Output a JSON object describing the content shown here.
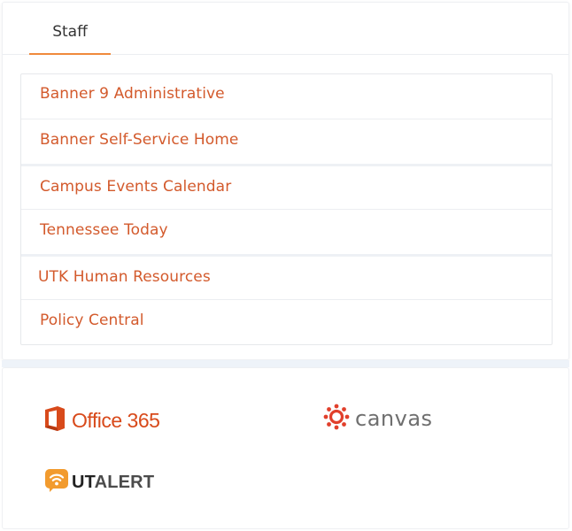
{
  "tabs": [
    {
      "label": "Staff",
      "active": true
    }
  ],
  "links": [
    {
      "label": "Banner 9 Administrative"
    },
    {
      "label": "Banner Self-Service Home"
    },
    {
      "label": "Campus Events Calendar"
    },
    {
      "label": "Tennessee Today"
    },
    {
      "label": "UTK Human Resources"
    },
    {
      "label": "Policy Central"
    }
  ],
  "logos": {
    "office": {
      "text": "Office 365",
      "icon": "office-icon",
      "color": "#d84a1b"
    },
    "canvas": {
      "text": "canvas",
      "icon": "canvas-icon",
      "color": "#e13f2b"
    },
    "utalert": {
      "text_ut": "UT",
      "text_alert": "ALERT",
      "icon": "wifi-alert-icon",
      "color": "#f29b2e"
    }
  },
  "colors": {
    "link": "#d35a2c",
    "tab_accent": "#f08a3c"
  }
}
